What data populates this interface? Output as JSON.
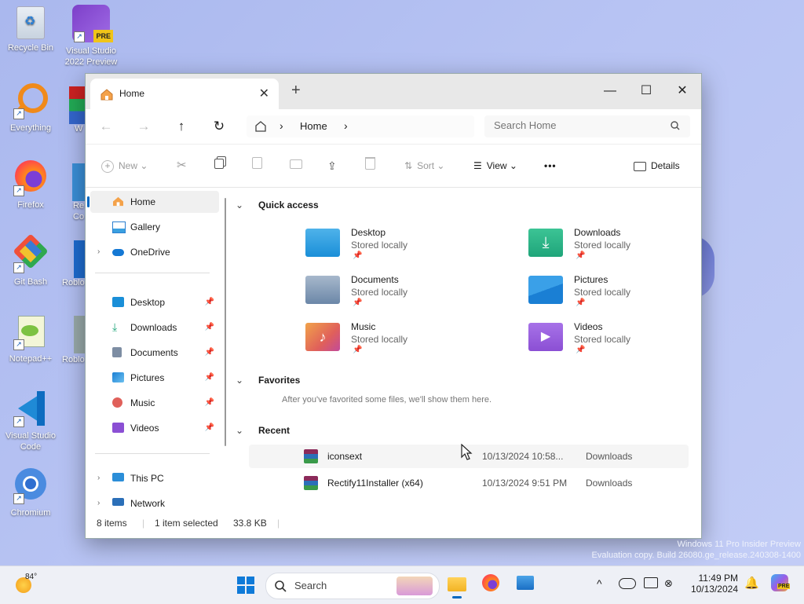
{
  "desktop": {
    "icons": [
      {
        "label_1": "Recycle Bin",
        "label_2": ""
      },
      {
        "label_1": "Visual Studio",
        "label_2": "2022 Preview",
        "badge": "PRE"
      },
      {
        "label_1": "Everything",
        "label_2": ""
      },
      {
        "label_1": "Firefox",
        "label_2": ""
      },
      {
        "label_1": "Git Bash",
        "label_2": ""
      },
      {
        "label_1": "Notepad++",
        "label_2": ""
      },
      {
        "label_1": "Visual Studio",
        "label_2": "Code"
      },
      {
        "label_1": "Chromium",
        "label_2": ""
      }
    ],
    "cut_labels": [
      "W",
      "Re",
      "Co",
      "Roblo",
      "Roblo"
    ],
    "watermark_line1": "Windows 11 Pro Insider Preview",
    "watermark_line2": "Evaluation copy. Build 26080.ge_release.240308-1400"
  },
  "explorer": {
    "tab_title": "Home",
    "tab_close": "✕",
    "new_tab": "+",
    "window_controls": {
      "minimize": "—",
      "maximize": "☐",
      "close": "✕"
    },
    "nav": {
      "back": "←",
      "forward": "→",
      "up": "↑",
      "refresh": "↻"
    },
    "breadcrumb": {
      "current": "Home",
      "separator": "›"
    },
    "search_placeholder": "Search Home",
    "toolbar": {
      "new_label": "New",
      "sort_label": "Sort",
      "view_label": "View",
      "more_label": "•••",
      "details_label": "Details"
    },
    "sidebar": {
      "home": "Home",
      "gallery": "Gallery",
      "onedrive": "OneDrive",
      "pinned": [
        "Desktop",
        "Downloads",
        "Documents",
        "Pictures",
        "Music",
        "Videos"
      ],
      "this_pc": "This PC",
      "network": "Network"
    },
    "sections": {
      "quick_access": "Quick access",
      "favorites": "Favorites",
      "favorites_empty": "After you've favorited some files, we'll show them here.",
      "recent": "Recent"
    },
    "quick_access_items": [
      {
        "name": "Desktop",
        "status": "Stored locally",
        "color": "#1a8fd8"
      },
      {
        "name": "Downloads",
        "status": "Stored locally",
        "color": "#1fa57a"
      },
      {
        "name": "Documents",
        "status": "Stored locally",
        "color": "#6b87a8"
      },
      {
        "name": "Pictures",
        "status": "Stored locally",
        "color": "#1a7fd4"
      },
      {
        "name": "Music",
        "status": "Stored locally",
        "color": "#e0605a"
      },
      {
        "name": "Videos",
        "status": "Stored locally",
        "color": "#8b4fd4"
      }
    ],
    "recent_items": [
      {
        "name": "iconsext",
        "date": "10/13/2024 10:58...",
        "location": "Downloads"
      },
      {
        "name": "Rectify11Installer (x64)",
        "date": "10/13/2024 9:51 PM",
        "location": "Downloads"
      }
    ],
    "status_bar": {
      "items": "8 items",
      "selected": "1 item selected",
      "size": "33.8 KB"
    }
  },
  "taskbar": {
    "weather_temp": "84°",
    "search_label": "Search",
    "clock_time": "11:49 PM",
    "clock_date": "10/13/2024",
    "tray_chevron": "^",
    "copilot_badge": "PRE"
  },
  "colors": {
    "accent": "#0067c0",
    "taskbar_bg": "#eef0f6"
  }
}
